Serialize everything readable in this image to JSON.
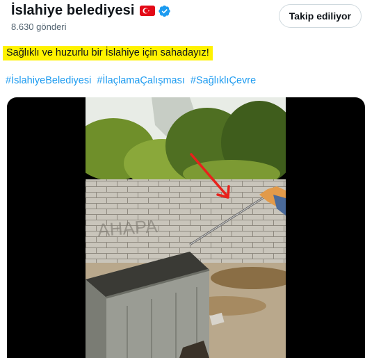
{
  "profile": {
    "name": "İslahiye belediyesi",
    "flag_icon": "turkey-flag-icon",
    "verified_icon": "verified-badge-icon",
    "posts_count": "8.630 gönderi"
  },
  "follow_button": {
    "label": "Takip ediliyor"
  },
  "tweet": {
    "text": "Sağlıklı ve huzurlu bir İslahiye için sahadayız!",
    "highlight_color": "#fff200",
    "hashtags": [
      "#İslahiyeBelediyesi",
      "#İlaçlamaÇalışması",
      "#SağlıklıÇevre"
    ],
    "hashtag_color": "#1d9bf0"
  },
  "media": {
    "type": "video",
    "scene": "spraying-near-dumpster",
    "annotation_icon": "red-arrow-icon"
  },
  "colors": {
    "verified": "#1d9bf0",
    "flag": "#e30a17"
  }
}
